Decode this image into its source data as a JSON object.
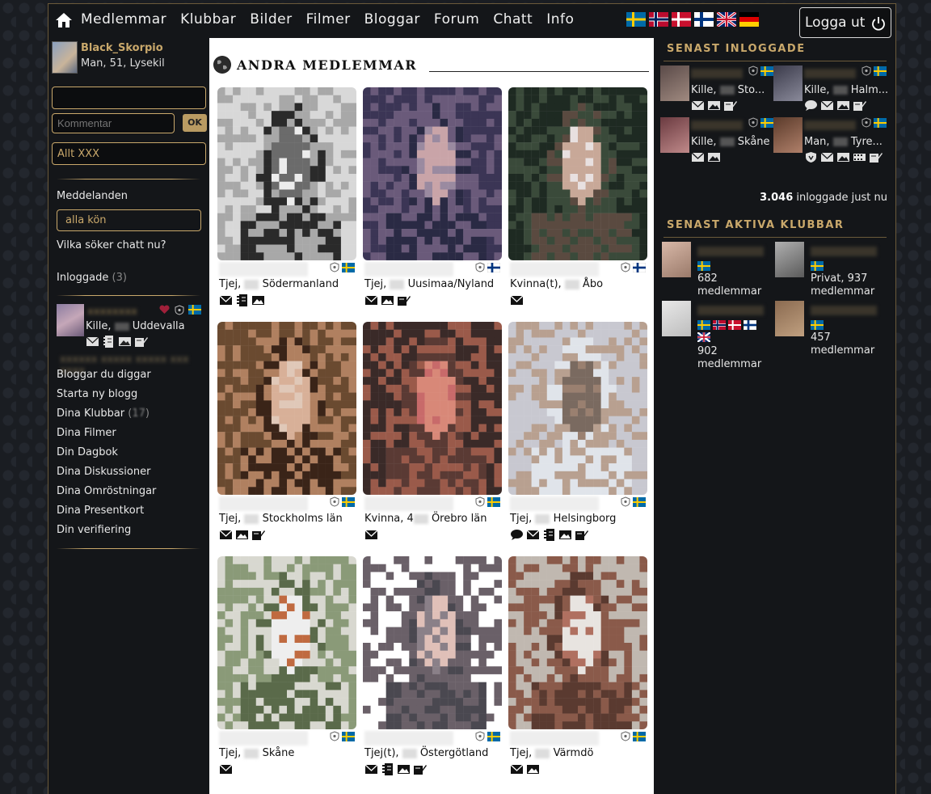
{
  "nav": {
    "links": [
      "Medlemmar",
      "Klubbar",
      "Bilder",
      "Filmer",
      "Bloggar",
      "Forum",
      "Chatt",
      "Info"
    ],
    "logout_label": "Logga ut"
  },
  "me": {
    "name": "Black_Skorpio",
    "info": "Man, 51, Lysekil"
  },
  "left": {
    "search_value": "",
    "comment_placeholder": "Kommentar",
    "ok_label": "OK",
    "filter_label": "Allt XXX",
    "messages_label": "Meddelanden",
    "gender_select": "alla kön",
    "who_chat": "Vilka söker chatt nu?",
    "logged_in_label": "Inloggade",
    "logged_in_count": "(3)",
    "online_user_info": "Kille, ",
    "online_user_place": "Uddevalla",
    "links": [
      "Bloggar du diggar",
      "Starta ny blogg",
      "Dina Klubbar",
      "Dina Filmer",
      "Din Dagbok",
      "Dina Diskussioner",
      "Dina Omröstningar",
      "Dina Presentkort",
      "Din verifiering"
    ],
    "clubs_count": "17"
  },
  "center": {
    "title": "ANDRA MEDLEMMAR",
    "members": [
      {
        "gender": "Tjej, ",
        "place": "Södermanland",
        "flag": "se",
        "icons": [
          "mail",
          "note",
          "photo"
        ]
      },
      {
        "gender": "Tjej, ",
        "place": "Uusimaa/Nyland",
        "flag": "fi",
        "icons": [
          "mail",
          "photo",
          "blog"
        ]
      },
      {
        "gender": "Kvinna(t), ",
        "place": "Åbo",
        "flag": "fi",
        "icons": [
          "mail"
        ]
      },
      {
        "gender": "Tjej, ",
        "place": "Stockholms län",
        "flag": "se",
        "icons": [
          "mail",
          "photo",
          "blog"
        ]
      },
      {
        "gender": "Kvinna, 4",
        "place": "Örebro län",
        "flag": "se",
        "icons": [
          "mail"
        ]
      },
      {
        "gender": "Tjej, ",
        "place": "Helsingborg",
        "flag": "se",
        "icons": [
          "chat",
          "mail",
          "note",
          "photo",
          "blog"
        ]
      },
      {
        "gender": "Tjej, ",
        "place": "Skåne",
        "flag": "se",
        "icons": [
          "mail"
        ]
      },
      {
        "gender": "Tjej(t), ",
        "place": "Östergötland",
        "flag": "se",
        "icons": [
          "mail",
          "note",
          "photo",
          "blog"
        ]
      },
      {
        "gender": "Tjej, ",
        "place": "Värmdö",
        "flag": "se",
        "icons": [
          "mail",
          "photo"
        ]
      }
    ]
  },
  "right": {
    "recent_title": "SENAST INLOGGADE",
    "recent": [
      {
        "info": "Kille, ",
        "place": "Sto..."
      },
      {
        "info": "Kille, ",
        "place": "Halm..."
      },
      {
        "info": "Kille, ",
        "place": "Skåne"
      },
      {
        "info": "Man, ",
        "place": "Tyre..."
      }
    ],
    "online_count": "3.046",
    "online_text": "inloggade just nu",
    "clubs_title": "SENAST AKTIVA KLUBBAR",
    "clubs": [
      {
        "count": "682",
        "unit": "medlemmar"
      },
      {
        "count": "Privat, 937",
        "unit": "medlemmar"
      },
      {
        "count": "902",
        "unit": "medlemmar"
      },
      {
        "count": "457",
        "unit": "medlemmar"
      }
    ]
  },
  "colors": {
    "gold": "#c9a86b",
    "bg": "#141619"
  }
}
